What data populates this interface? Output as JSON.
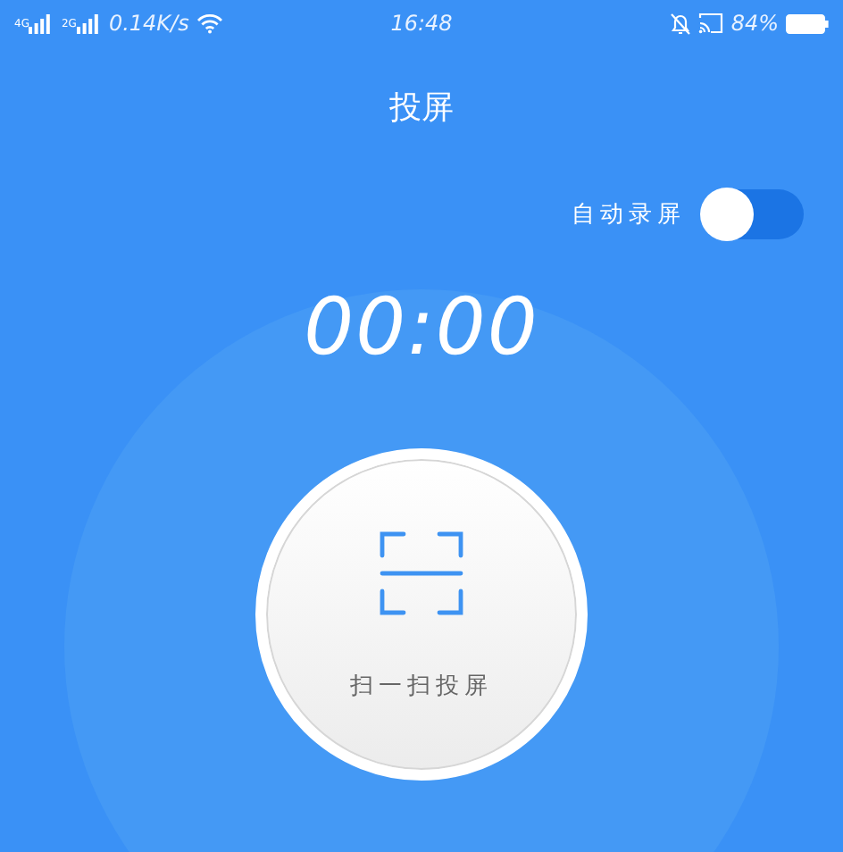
{
  "status_bar": {
    "networks": [
      {
        "label": "4G"
      },
      {
        "label": "2G"
      }
    ],
    "speed": "0.14K/s",
    "time": "16:48",
    "battery": "84%"
  },
  "title": "投屏",
  "auto_record": {
    "label": "自动录屏",
    "on": false
  },
  "timer": "00:00",
  "scan_button": {
    "label": "扫一扫投屏"
  }
}
